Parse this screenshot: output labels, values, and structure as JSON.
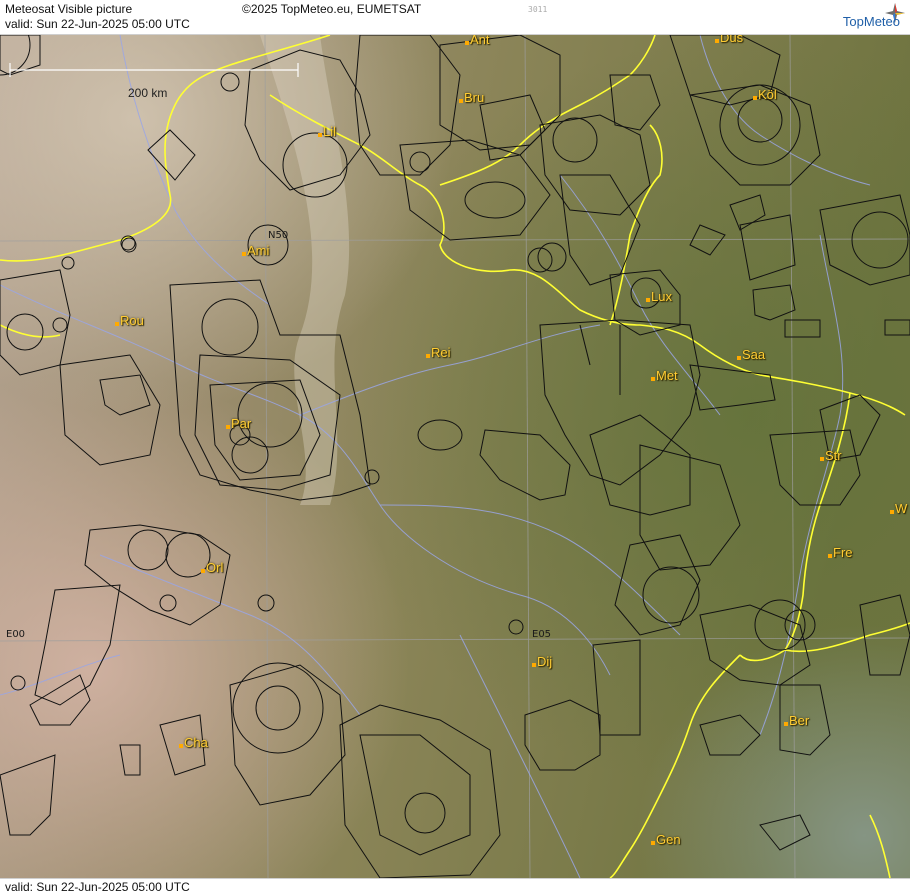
{
  "header": {
    "title": "Meteosat Visible picture",
    "valid": "valid:  Sun  22-Jun-2025  05:00 UTC",
    "copyright": "©2025 TopMeteo.eu, EUMETSAT",
    "code": "3011",
    "brand": "TopMeteo"
  },
  "footer": {
    "valid": "valid:  Sun  22-Jun-2025  05:00 UTC"
  },
  "scale": {
    "label": "200 km"
  },
  "grid_labels": [
    "N50",
    "E00",
    "E05"
  ],
  "cities": [
    {
      "name": "Ant"
    },
    {
      "name": "Düs"
    },
    {
      "name": "Bru"
    },
    {
      "name": "Köl"
    },
    {
      "name": "Lil"
    },
    {
      "name": "Ami"
    },
    {
      "name": "Rou"
    },
    {
      "name": "Lux"
    },
    {
      "name": "Rei"
    },
    {
      "name": "Saa"
    },
    {
      "name": "Met"
    },
    {
      "name": "Par"
    },
    {
      "name": "Str"
    },
    {
      "name": "W"
    },
    {
      "name": "Fre"
    },
    {
      "name": "Orl"
    },
    {
      "name": "Dij"
    },
    {
      "name": "Ber"
    },
    {
      "name": "Cha"
    },
    {
      "name": "Gen"
    }
  ],
  "colors": {
    "border": "#ffff33",
    "rivers": "#9aa6e6",
    "airspace": "#111111",
    "city_label": "#ffcc33",
    "brand": "#1f5fa8"
  }
}
